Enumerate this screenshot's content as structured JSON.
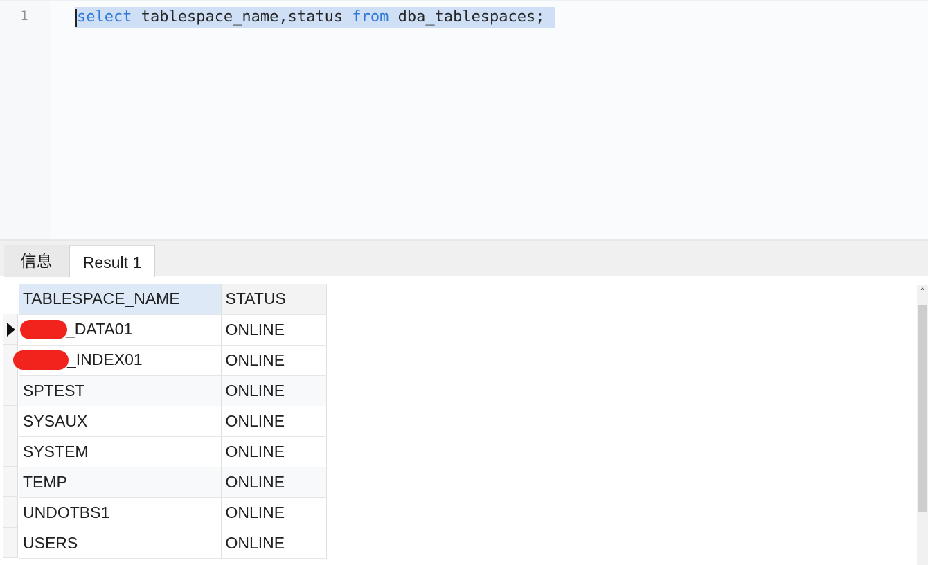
{
  "editor": {
    "line_number": "1",
    "code": {
      "kw_select": "select",
      "middle": " tablespace_name,status ",
      "kw_from": "from",
      "tail": " dba_tablespaces;"
    }
  },
  "tabs": [
    {
      "label": "信息"
    },
    {
      "label": "Result 1"
    }
  ],
  "grid": {
    "columns": [
      "TABLESPACE_NAME",
      "STATUS"
    ],
    "rows": [
      {
        "name": "_DATA01",
        "status": "ONLINE"
      },
      {
        "name": "_INDEX01",
        "status": "ONLINE"
      },
      {
        "name": "SPTEST",
        "status": "ONLINE"
      },
      {
        "name": "SYSAUX",
        "status": "ONLINE"
      },
      {
        "name": "SYSTEM",
        "status": "ONLINE"
      },
      {
        "name": "TEMP",
        "status": "ONLINE"
      },
      {
        "name": "UNDOTBS1",
        "status": "ONLINE"
      },
      {
        "name": "USERS",
        "status": "ONLINE"
      }
    ]
  },
  "icons": {
    "current_row": "triangle-right-icon",
    "scroll_up": "chevron-up-icon"
  },
  "colors": {
    "keyword": "#2f79d6",
    "selection": "#cfe0f6",
    "header_selected": "#dde9f7",
    "redaction": "#f0241c"
  }
}
